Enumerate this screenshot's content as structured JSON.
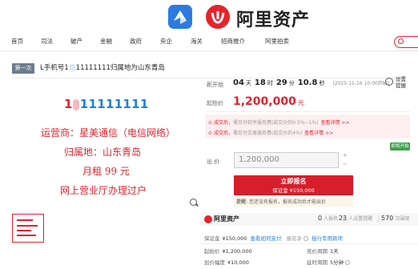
{
  "brand": {
    "name": "阿里资产"
  },
  "nav": {
    "items": [
      "首页",
      "司法",
      "破产",
      "金融",
      "政府",
      "央企",
      "海关",
      "招商推介",
      "阿里拍卖"
    ]
  },
  "lot": {
    "tag": "第一次",
    "title_prefix": "L手机号1",
    "title_suffix": "11111111归属地为山东青岛"
  },
  "image": {
    "phone_prefix": "1",
    "phone_suffix": "11111111",
    "lines": [
      "运营商：星美通信（电信网络）",
      "归属地：山东青岛",
      "月租 99 元",
      "网上营业厅办理过户"
    ]
  },
  "countdown": {
    "label": "距开始",
    "days": "04",
    "days_unit": "天",
    "hours": "18",
    "hours_unit": "时",
    "minutes": "29",
    "minutes_unit": "分",
    "seconds": "10.8",
    "seconds_unit": "秒",
    "end_time": "(2025-11-16 10:00开始)"
  },
  "remind": {
    "line1": "设置",
    "line2": "提醒"
  },
  "start_price": {
    "label": "起拍价",
    "value": "1,200,000",
    "unit": "元"
  },
  "notices": [
    {
      "prefix": "成交后，",
      "text": "需另付软件服务费(成交价的0.5%~1%)",
      "link": "查看详情 >>"
    },
    {
      "prefix": "成交后，",
      "text": "需另付交易服务费(成交价的4%)",
      "link": "查看详情 >>"
    }
  ],
  "favorite_badge": "即将开拍",
  "bid": {
    "label": "出 价",
    "value": "1,200,000",
    "step_up": "+",
    "step_down": "−"
  },
  "apply_button": {
    "label": "立即报名",
    "sub": "保证金 ¥150,000"
  },
  "tip": {
    "label": "提醒:",
    "text": "您还没有报名，报名成功后才能出价"
  },
  "stats": {
    "brand": "阿里资产",
    "apply": {
      "value": "0",
      "label": "人报名"
    },
    "remind": {
      "value": "23",
      "label": "人设置提醒"
    },
    "view": {
      "value": "570",
      "label": "次围观"
    }
  },
  "info": {
    "deposit": {
      "label": "保证金",
      "value": "¥150,000",
      "link1": "查看如何支付",
      "extra_label": "报名享",
      "link2": "授行专用款项"
    },
    "start": {
      "label": "起拍价",
      "value": "¥1,200,000"
    },
    "increment": {
      "label": "加价幅度",
      "value": "¥10,000"
    },
    "cycle": {
      "label": "竞价周期",
      "value": "1天"
    },
    "delay": {
      "label": "延时周期",
      "value": "5分钟"
    }
  },
  "colors": {
    "brand_red": "#e0232c",
    "link_blue": "#1c7fd8",
    "badge_green": "#3fa34d"
  }
}
